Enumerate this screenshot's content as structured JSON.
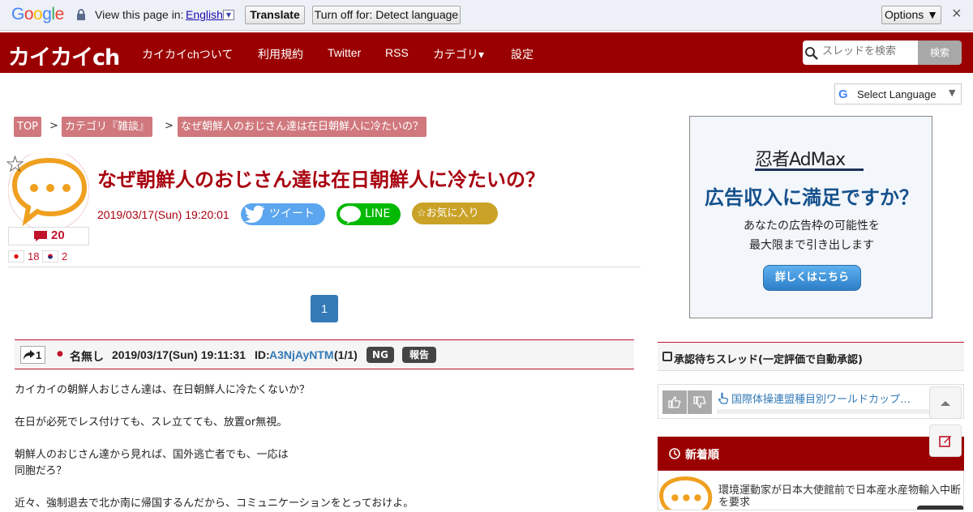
{
  "translate_bar": {
    "logo": "Google",
    "prompt": "View this page in:",
    "language": "English",
    "translate_label": "Translate",
    "turn_off_label": "Turn off for: Detect language",
    "options_label": "Options ▼",
    "close_label": "×"
  },
  "nav": {
    "brand": "カイカイch",
    "items": [
      "カイカイchついて",
      "利用規約",
      "Twitter",
      "RSS",
      "カテゴリ▾",
      "設定"
    ],
    "search_placeholder": "スレッドを検索",
    "search_button": "検索"
  },
  "select_language": "Select Language",
  "breadcrumb": [
    "TOP",
    "カテゴリ『雑談』",
    "なぜ朝鮮人のおじさん達は在日朝鮮人に冷たいの？"
  ],
  "thread": {
    "title": "なぜ朝鮮人のおじさん達は在日朝鮮人に冷たいの？",
    "date": "2019/03/17(Sun) 19:20:01",
    "comment_count": "20",
    "jp_count": "18",
    "kr_count": "2",
    "tweet_label": "ツイート",
    "line_label": "LINE",
    "favorite_label": "☆お気に入り"
  },
  "pagination": {
    "current": "1"
  },
  "post": {
    "number": "1",
    "name": "名無し",
    "datetime": "2019/03/17(Sun) 19:11:31",
    "id_label": "ID:",
    "id": "A3NjAyNTM",
    "id_count": "(1/1)",
    "ng_label": "NG",
    "report_label": "報告",
    "lines": [
      "カイカイの朝鮮人おじさん達は、在日朝鮮人に冷たくないか？",
      "",
      "在日が必死でレス付けても、スレ立てても、放置or無視。",
      "",
      "朝鮮人のおじさん達から見れば、国外逃亡者でも、一応は",
      "同胞だろ？",
      "",
      "近々、強制退去で北か南に帰国するんだから、コミュニケーションをとっておけよ。"
    ]
  },
  "ad": {
    "logo": "忍者AdMax",
    "headline": "広告収入に満足ですか？",
    "sub1": "あなたの広告枠の可能性を",
    "sub2": "最大限まで引き出します",
    "cta": "詳しくはこちら"
  },
  "sidebar": {
    "pending_title": "承認待ちスレッド(一定評価で自動承認)",
    "pending_item": "国際体操連盟種目別ワールドカップ…",
    "newest_title": "新着順",
    "newest_item": "環境運動家が日本大使館前で日本産水産物輸入中断を要求"
  },
  "colors": {
    "brand_red": "#9b0000",
    "title_red": "#a8000f",
    "link_blue": "#337ab7"
  }
}
